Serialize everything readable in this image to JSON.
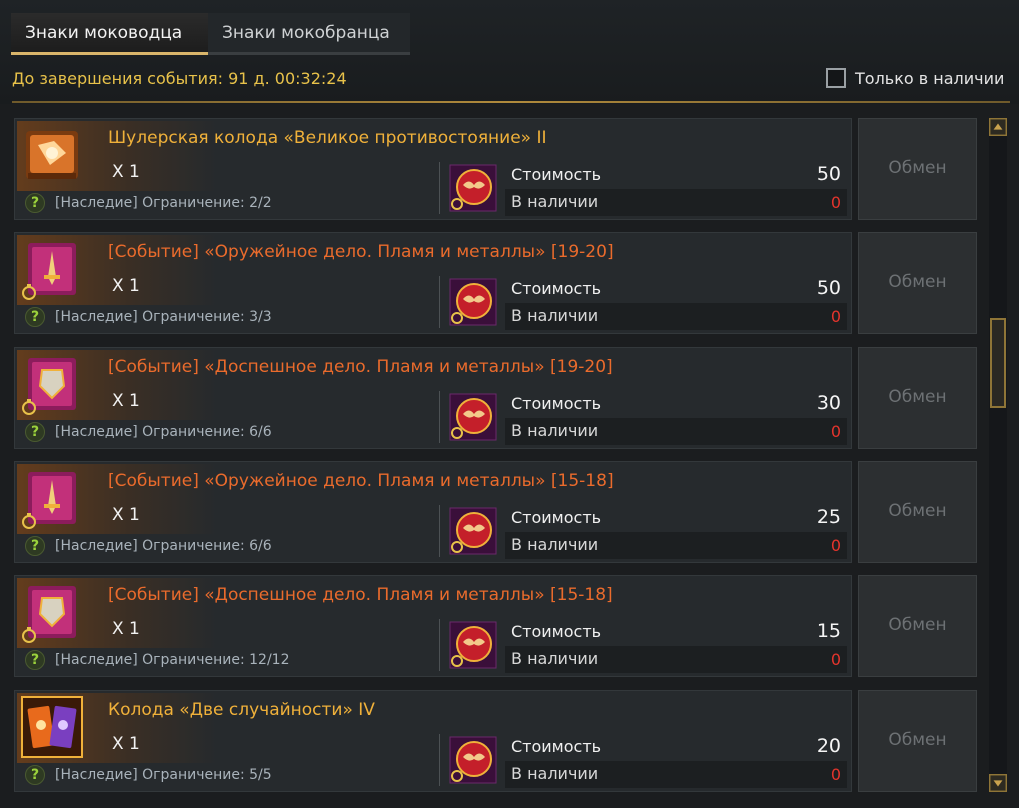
{
  "tabs": [
    {
      "label": "Знаки моководца",
      "active": true
    },
    {
      "label": "Знаки мокобранца",
      "active": false
    }
  ],
  "event_timer": "До завершения события: 91 д. 00:32:24",
  "filter": {
    "label": "Только в наличии",
    "checked": false
  },
  "labels": {
    "cost": "Стоимость",
    "in_stock": "В наличии",
    "exchange": "Обмен",
    "help": "?"
  },
  "items": [
    {
      "name": "Шулерская колода «Великое противостояние» II",
      "color": "gold",
      "icon": "card-deck-icon",
      "qty": "X 1",
      "limit": "[Наследие] Ограничение: 2/2",
      "cost": "50",
      "stock": "0"
    },
    {
      "name": "[Событие] «Оружейное дело. Пламя и металлы» [19-20]",
      "color": "orange",
      "icon": "weapon-book-icon",
      "qty": "X 1",
      "limit": "[Наследие] Ограничение: 3/3",
      "cost": "50",
      "stock": "0"
    },
    {
      "name": "[Событие] «Доспешное дело. Пламя и металлы» [19-20]",
      "color": "orange",
      "icon": "armor-book-icon",
      "qty": "X 1",
      "limit": "[Наследие] Ограничение: 6/6",
      "cost": "30",
      "stock": "0"
    },
    {
      "name": "[Событие] «Оружейное дело. Пламя и металлы» [15-18]",
      "color": "orange",
      "icon": "weapon-book-icon",
      "qty": "X 1",
      "limit": "[Наследие] Ограничение: 6/6",
      "cost": "25",
      "stock": "0"
    },
    {
      "name": "[Событие] «Доспешное дело. Пламя и металлы» [15-18]",
      "color": "orange",
      "icon": "armor-book-icon",
      "qty": "X 1",
      "limit": "[Наследие] Ограничение: 12/12",
      "cost": "15",
      "stock": "0"
    },
    {
      "name": "Колода «Две случайности» IV",
      "color": "gold",
      "icon": "card-pair-icon",
      "qty": "X 1",
      "limit": "[Наследие] Ограничение: 5/5",
      "cost": "20",
      "stock": "0"
    }
  ],
  "colors": {
    "gold_name": "#f0b13a",
    "event_name": "#ea6b2c",
    "timer": "#e8c24a",
    "stock_zero": "#e3342c",
    "accent": "#d9b56b"
  }
}
